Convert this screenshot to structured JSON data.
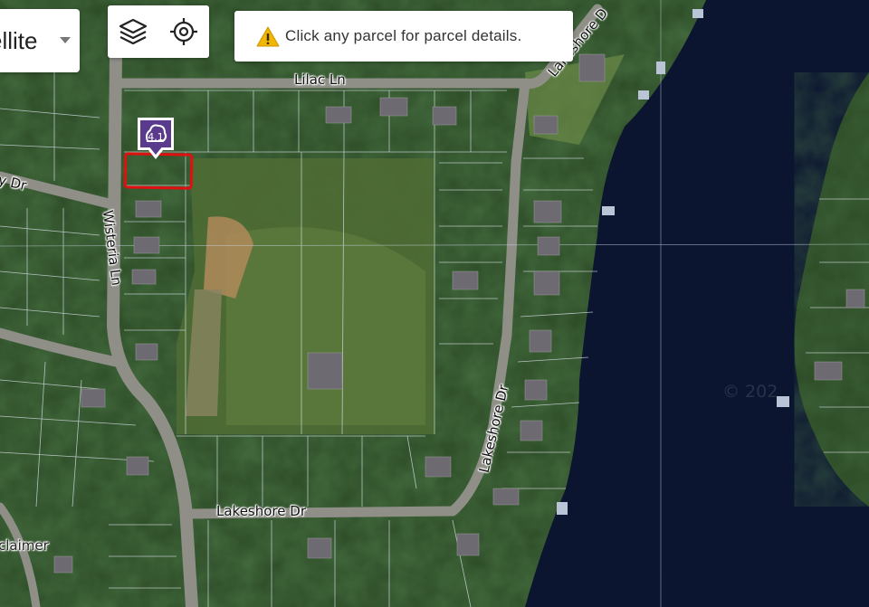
{
  "map_type": {
    "label": "Satellite",
    "visible_label": "ellite"
  },
  "tools": {
    "layers_icon": "layers-icon",
    "locate_icon": "crosshair-icon"
  },
  "notice": {
    "icon": "warning-icon",
    "text": "Click any parcel for parcel details."
  },
  "marker": {
    "icon": "parcel-pin-icon"
  },
  "roads": {
    "lilac": "Lilac Ln",
    "wisteria": "Wisteria Ln",
    "lakeshore_bottom": "Lakeshore Dr",
    "lakeshore_mid": "Lakeshore Dr",
    "lakeshore_top": "Lakeshore D",
    "left_dr": "y Dr",
    "disclaimer": "claimer"
  },
  "watermark": "© 202",
  "colors": {
    "water": "#0b1530",
    "selection": "#e01010",
    "pin": "#5a3a8c"
  }
}
